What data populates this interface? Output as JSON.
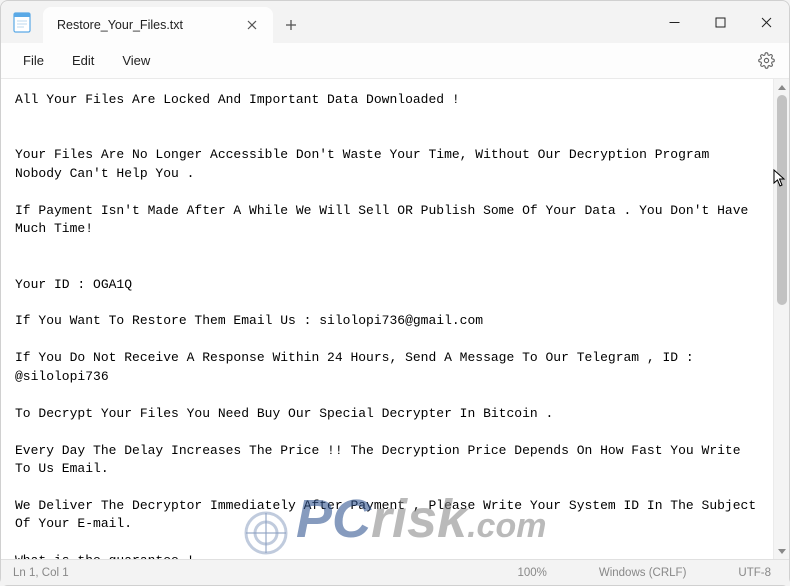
{
  "titlebar": {
    "tab_title": "Restore_Your_Files.txt"
  },
  "menubar": {
    "file": "File",
    "edit": "Edit",
    "view": "View"
  },
  "content": {
    "text": "All Your Files Are Locked And Important Data Downloaded !\n\n\nYour Files Are No Longer Accessible Don't Waste Your Time, Without Our Decryption Program Nobody Can't Help You .\n\nIf Payment Isn't Made After A While We Will Sell OR Publish Some Of Your Data . You Don't Have Much Time!\n\n\nYour ID : OGA1Q\n\nIf You Want To Restore Them Email Us : silolopi736@gmail.com\n\nIf You Do Not Receive A Response Within 24 Hours, Send A Message To Our Telegram , ID : @silolopi736\n\nTo Decrypt Your Files You Need Buy Our Special Decrypter In Bitcoin .\n\nEvery Day The Delay Increases The Price !! The Decryption Price Depends On How Fast You Write To Us Email.\n\nWe Deliver The Decryptor Immediately After Payment , Please Write Your System ID In The Subject Of Your E-mail.\n\nWhat is the guarantee !"
  },
  "statusbar": {
    "position": "Ln 1, Col 1",
    "zoom": "100%",
    "line_ending": "Windows (CRLF)",
    "encoding": "UTF-8"
  },
  "watermark": {
    "pc": "PC",
    "risk": "risk",
    "com": ".com"
  }
}
